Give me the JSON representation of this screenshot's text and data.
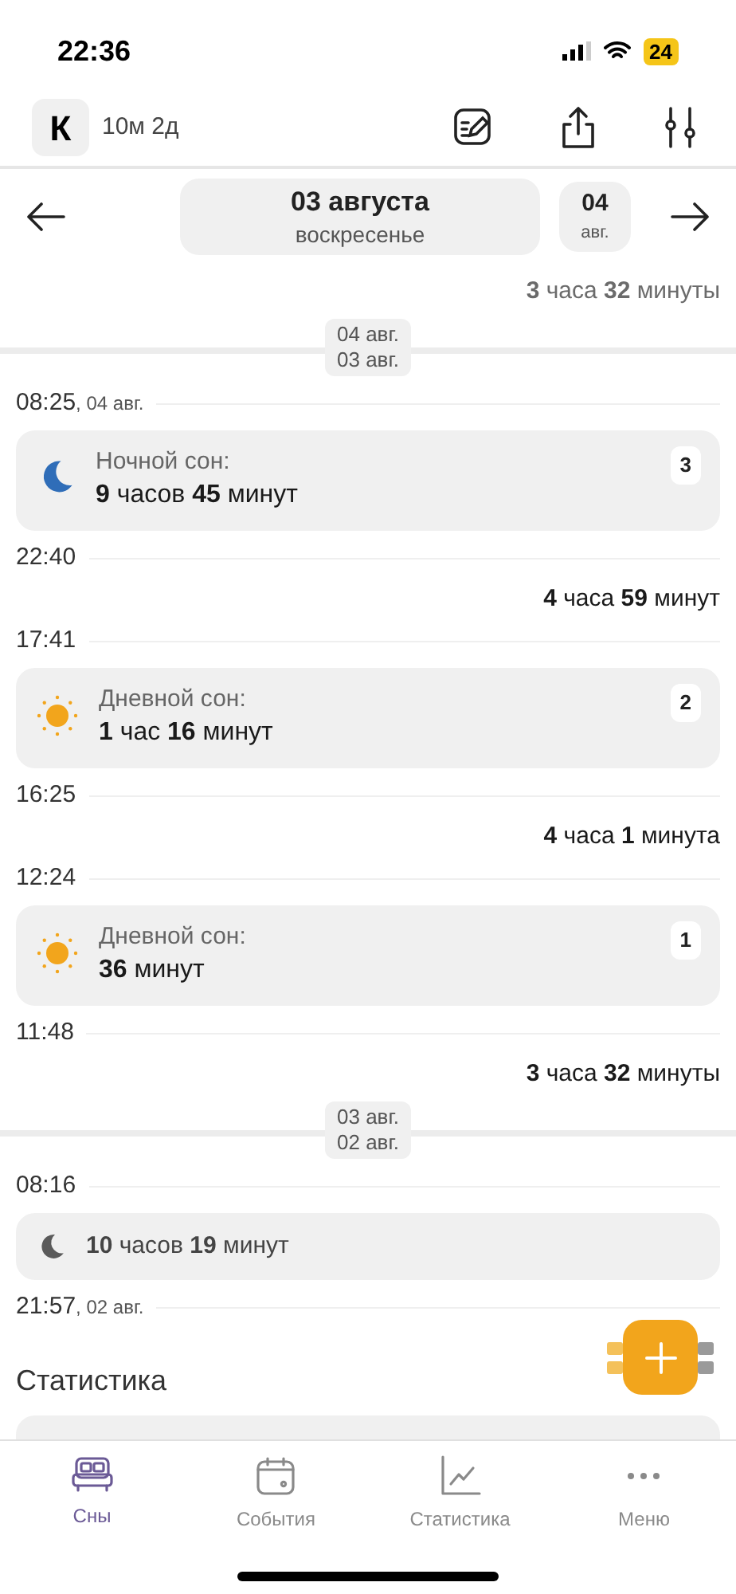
{
  "status_bar": {
    "time": "22:36",
    "battery": "24"
  },
  "header": {
    "avatar_letter": "К",
    "age": "10м 2д"
  },
  "date_nav": {
    "title": "03 августа",
    "weekday": "воскресенье",
    "next_day": "04",
    "next_month": "авг."
  },
  "timeline": [
    {
      "kind": "gap",
      "text": "**3** часа **32** минуты",
      "dimmed": true
    },
    {
      "kind": "day_divider",
      "upper": "04 авг.",
      "lower": "03 авг."
    },
    {
      "kind": "time",
      "time": "08:25",
      "date": ", 04 авг."
    },
    {
      "kind": "night_sleep",
      "label": "Ночной сон:",
      "duration": "**9** часов **45** минут",
      "badge": "3"
    },
    {
      "kind": "time",
      "time": "22:40"
    },
    {
      "kind": "gap",
      "text": "**4** часа **59** минут",
      "dimmed": false
    },
    {
      "kind": "time",
      "time": "17:41"
    },
    {
      "kind": "day_sleep",
      "label": "Дневной сон:",
      "duration": "**1** час **16** минут",
      "badge": "2"
    },
    {
      "kind": "time",
      "time": "16:25"
    },
    {
      "kind": "gap",
      "text": "**4** часа **1** минута",
      "dimmed": false
    },
    {
      "kind": "time",
      "time": "12:24"
    },
    {
      "kind": "day_sleep",
      "label": "Дневной сон:",
      "duration": "**36** минут",
      "badge": "1"
    },
    {
      "kind": "time",
      "time": "11:48"
    },
    {
      "kind": "gap",
      "text": "**3** часа **32** минуты",
      "dimmed": false
    },
    {
      "kind": "day_divider",
      "upper": "03 авг.",
      "lower": "02 авг."
    },
    {
      "kind": "time",
      "time": "08:16"
    },
    {
      "kind": "compact",
      "text": "**10** часов **19** минут"
    },
    {
      "kind": "time",
      "time": "21:57",
      "date": ", 02 авг."
    }
  ],
  "stats_heading": "Статистика",
  "tabs": [
    {
      "label": "Сны",
      "selected": true
    },
    {
      "label": "События",
      "selected": false
    },
    {
      "label": "Статистика",
      "selected": false
    },
    {
      "label": "Меню",
      "selected": false
    }
  ]
}
